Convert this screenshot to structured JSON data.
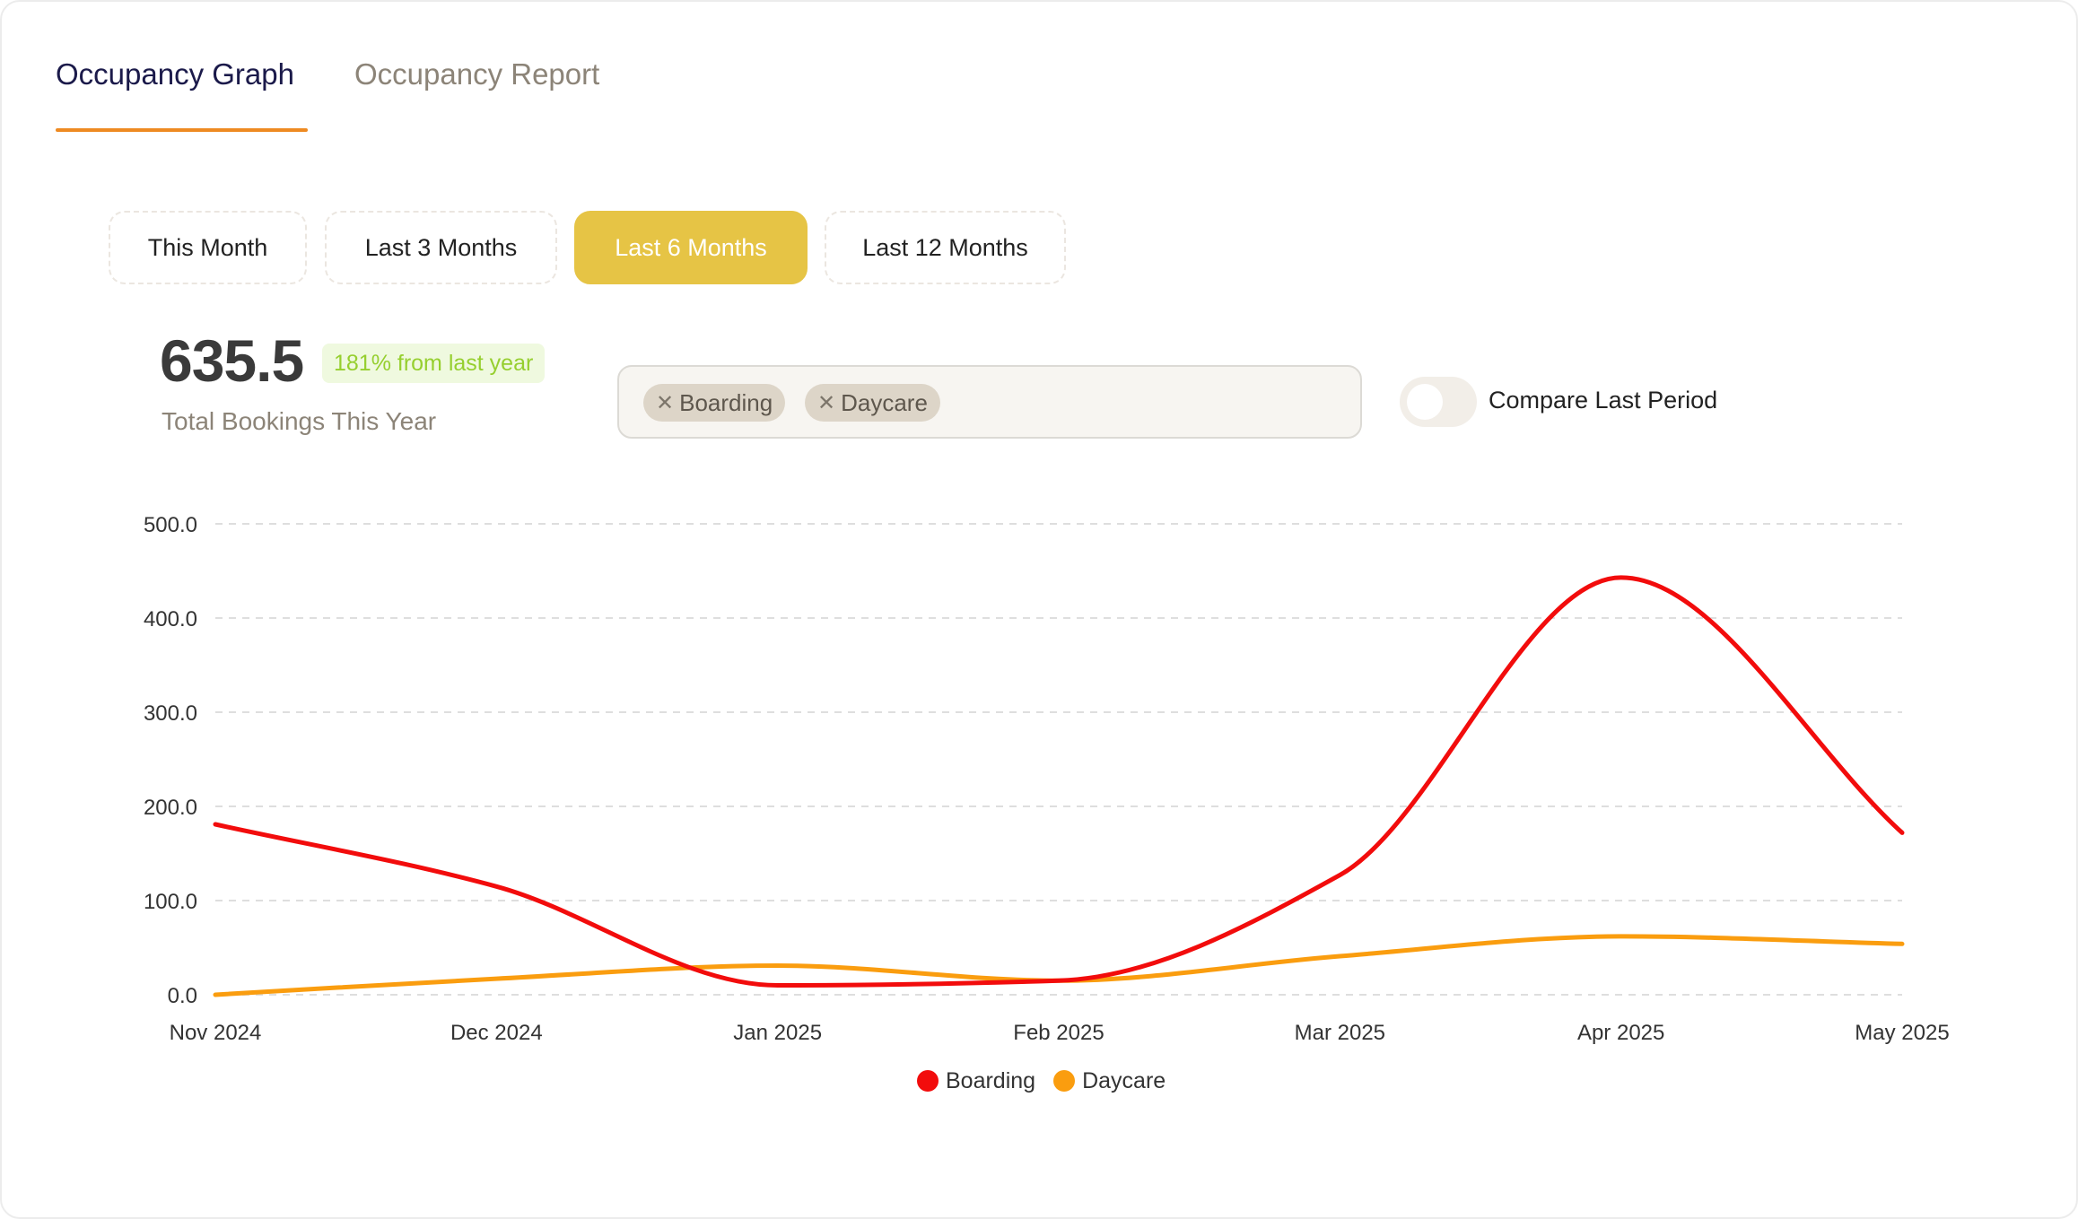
{
  "tabs": [
    {
      "label": "Occupancy Graph",
      "active": true
    },
    {
      "label": "Occupancy Report",
      "active": false
    }
  ],
  "ranges": [
    {
      "label": "This Month",
      "selected": false
    },
    {
      "label": "Last 3 Months",
      "selected": false
    },
    {
      "label": "Last 6 Months",
      "selected": true
    },
    {
      "label": "Last 12 Months",
      "selected": false
    }
  ],
  "summary": {
    "total": "635.5",
    "change": "181% from last year",
    "label": "Total Bookings This Year"
  },
  "filters": {
    "chips": [
      {
        "label": "Boarding",
        "remove_icon": "close-icon"
      },
      {
        "label": "Daycare",
        "remove_icon": "close-icon"
      }
    ]
  },
  "compare": {
    "label": "Compare Last Period",
    "enabled": false
  },
  "colors": {
    "accent": "#e6c445",
    "tab_underline": "#ee8a22",
    "boarding": "#f20c0c",
    "daycare": "#fa9d0f",
    "badge_text": "#96cf2f"
  },
  "chart_data": {
    "type": "line",
    "categories": [
      "Nov 2024",
      "Dec 2024",
      "Jan 2025",
      "Feb 2025",
      "Mar 2025",
      "Apr 2025",
      "May 2025"
    ],
    "series": [
      {
        "name": "Boarding",
        "color": "#f20c0c",
        "values": [
          181,
          115,
          10,
          15,
          127,
          443,
          172
        ]
      },
      {
        "name": "Daycare",
        "color": "#fa9d0f",
        "values": [
          0,
          17,
          31,
          15,
          41,
          62,
          54
        ]
      }
    ],
    "yticks": [
      "0.0",
      "100.0",
      "200.0",
      "300.0",
      "400.0",
      "500.0"
    ],
    "ylim": [
      0,
      500
    ],
    "grid": true,
    "smooth": true,
    "legend_position": "bottom"
  }
}
